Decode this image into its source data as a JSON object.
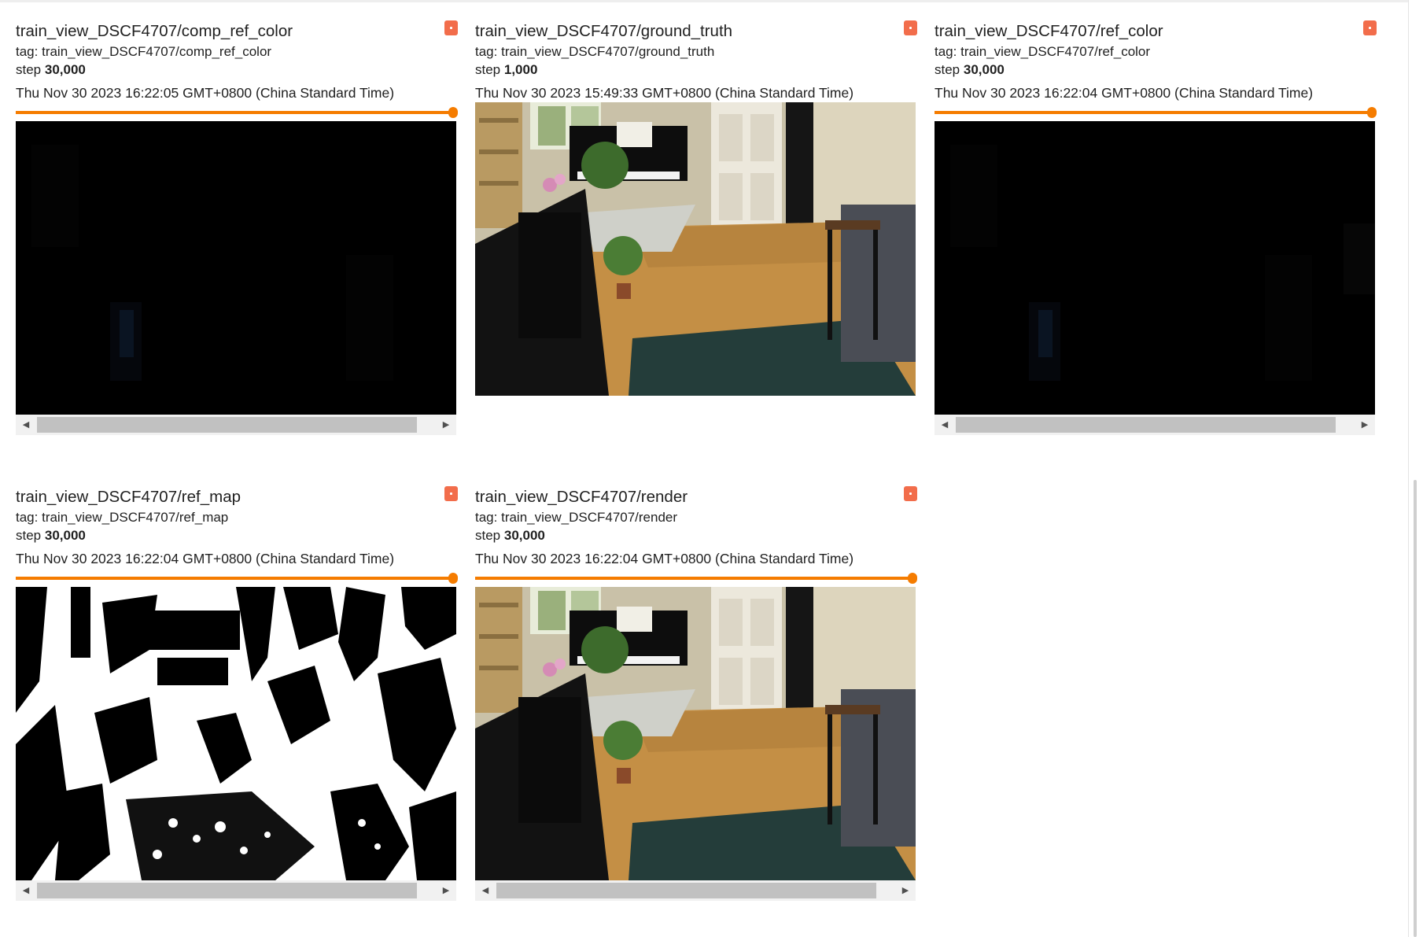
{
  "cards": [
    {
      "title": "train_view_DSCF4707/comp_ref_color",
      "tag_prefix": "tag: ",
      "tag": "train_view_DSCF4707/comp_ref_color",
      "step_label": "step ",
      "step": "30,000",
      "date": "Thu Nov 30 2023 16:22:05 GMT+0800 (China Standard Time)",
      "image_kind": "dark-render"
    },
    {
      "title": "train_view_DSCF4707/ground_truth",
      "tag_prefix": "tag: ",
      "tag": "train_view_DSCF4707/ground_truth",
      "step_label": "step ",
      "step": "1,000",
      "date": "Thu Nov 30 2023 15:49:33 GMT+0800 (China Standard Time)",
      "image_kind": "room-photo"
    },
    {
      "title": "train_view_DSCF4707/ref_color",
      "tag_prefix": "tag: ",
      "tag": "train_view_DSCF4707/ref_color",
      "step_label": "step ",
      "step": "30,000",
      "date": "Thu Nov 30 2023 16:22:04 GMT+0800 (China Standard Time)",
      "image_kind": "dark-render"
    },
    {
      "title": "train_view_DSCF4707/ref_map",
      "tag_prefix": "tag: ",
      "tag": "train_view_DSCF4707/ref_map",
      "step_label": "step ",
      "step": "30,000",
      "date": "Thu Nov 30 2023 16:22:04 GMT+0800 (China Standard Time)",
      "image_kind": "binary-map"
    },
    {
      "title": "train_view_DSCF4707/render",
      "tag_prefix": "tag: ",
      "tag": "train_view_DSCF4707/render",
      "step_label": "step ",
      "step": "30,000",
      "date": "Thu Nov 30 2023 16:22:04 GMT+0800 (China Standard Time)",
      "image_kind": "room-photo"
    }
  ],
  "colors": {
    "slider": "#f57c00",
    "pin_button": "#f26d4b",
    "scrollbar_track": "#f1f1f1",
    "scrollbar_thumb": "#c1c1c1"
  },
  "icons": {
    "pin": "pin-icon",
    "scroll_left": "scroll-left-arrow-icon",
    "scroll_right": "scroll-right-arrow-icon"
  }
}
